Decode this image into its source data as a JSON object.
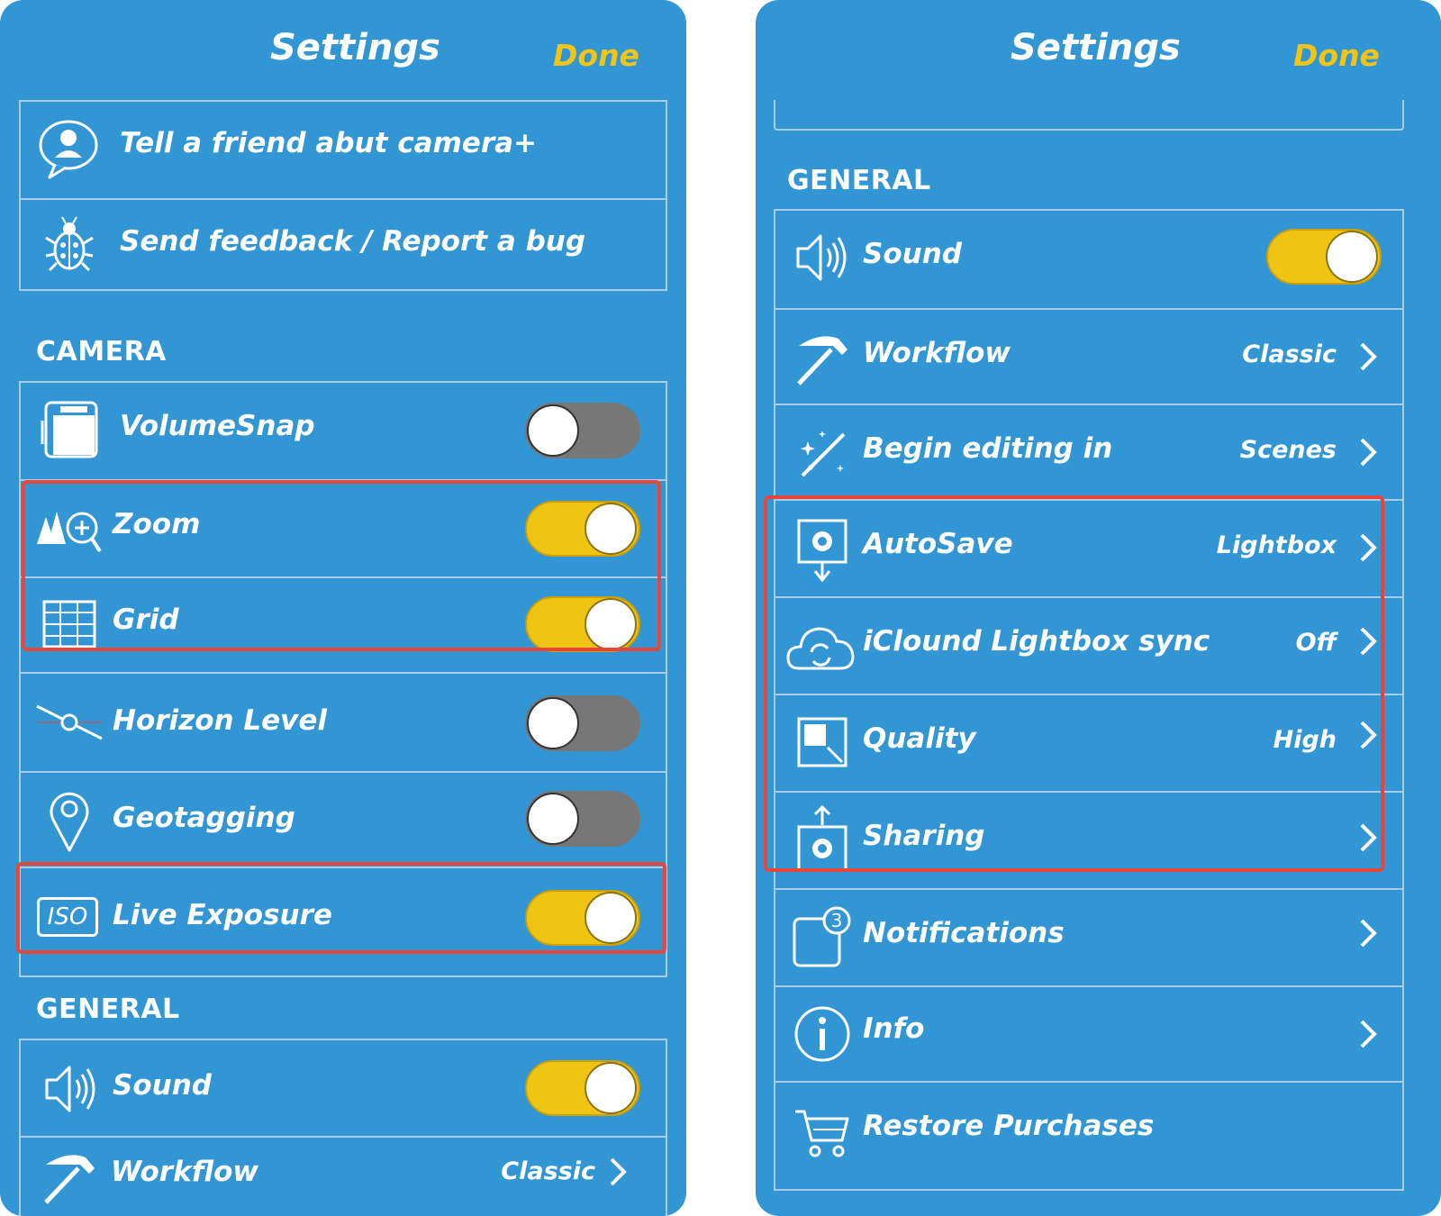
{
  "colors": {
    "panel": "#3196D3",
    "accent": "#F2C414",
    "divider": "#A9CDE8",
    "highlight": "#E8453B",
    "toggle_off": "#777777"
  },
  "left": {
    "title": "Settings",
    "done": "Done",
    "top_items": [
      {
        "label": "Tell a friend abut camera+",
        "icon": "chat-user-icon"
      },
      {
        "label": "Send feedback / Report a bug",
        "icon": "bug-icon"
      }
    ],
    "camera_header": "CAMERA",
    "camera_items": [
      {
        "label": "VolumeSnap",
        "icon": "phone-button-icon",
        "toggle": false
      },
      {
        "label": "Zoom",
        "icon": "zoom-icon",
        "toggle": true
      },
      {
        "label": "Grid",
        "icon": "grid-icon",
        "toggle": true
      },
      {
        "label": "Horizon Level",
        "icon": "horizon-icon",
        "toggle": false
      },
      {
        "label": "Geotagging",
        "icon": "location-pin-icon",
        "toggle": false
      },
      {
        "label": "Live Exposure",
        "icon": "iso-icon",
        "iso_text": "ISO",
        "toggle": true
      }
    ],
    "general_header": "GENERAL",
    "general_items": [
      {
        "label": "Sound",
        "icon": "speaker-icon",
        "toggle": true
      },
      {
        "label": "Workflow",
        "icon": "hammer-icon",
        "value": "Classic"
      }
    ]
  },
  "right": {
    "title": "Settings",
    "done": "Done",
    "general_header": "GENERAL",
    "items": [
      {
        "label": "Sound",
        "icon": "speaker-icon",
        "toggle": true
      },
      {
        "label": "Workflow",
        "icon": "hammer-icon",
        "value": "Classic"
      },
      {
        "label": "Begin editing in",
        "icon": "magic-wand-icon",
        "value": "Scenes"
      },
      {
        "label": "AutoSave",
        "icon": "autosave-gear-icon",
        "value": "Lightbox"
      },
      {
        "label": "iClound Lightbox sync",
        "icon": "cloud-sync-icon",
        "value": "Off"
      },
      {
        "label": "Quality",
        "icon": "quality-icon",
        "value": "High"
      },
      {
        "label": "Sharing",
        "icon": "share-gear-icon",
        "value": ""
      },
      {
        "label": "Notifications",
        "icon": "notification-badge-icon",
        "badge": "3",
        "value": ""
      },
      {
        "label": "Info",
        "icon": "info-icon",
        "value": ""
      },
      {
        "label": "Restore Purchases",
        "icon": "cart-icon"
      }
    ]
  }
}
